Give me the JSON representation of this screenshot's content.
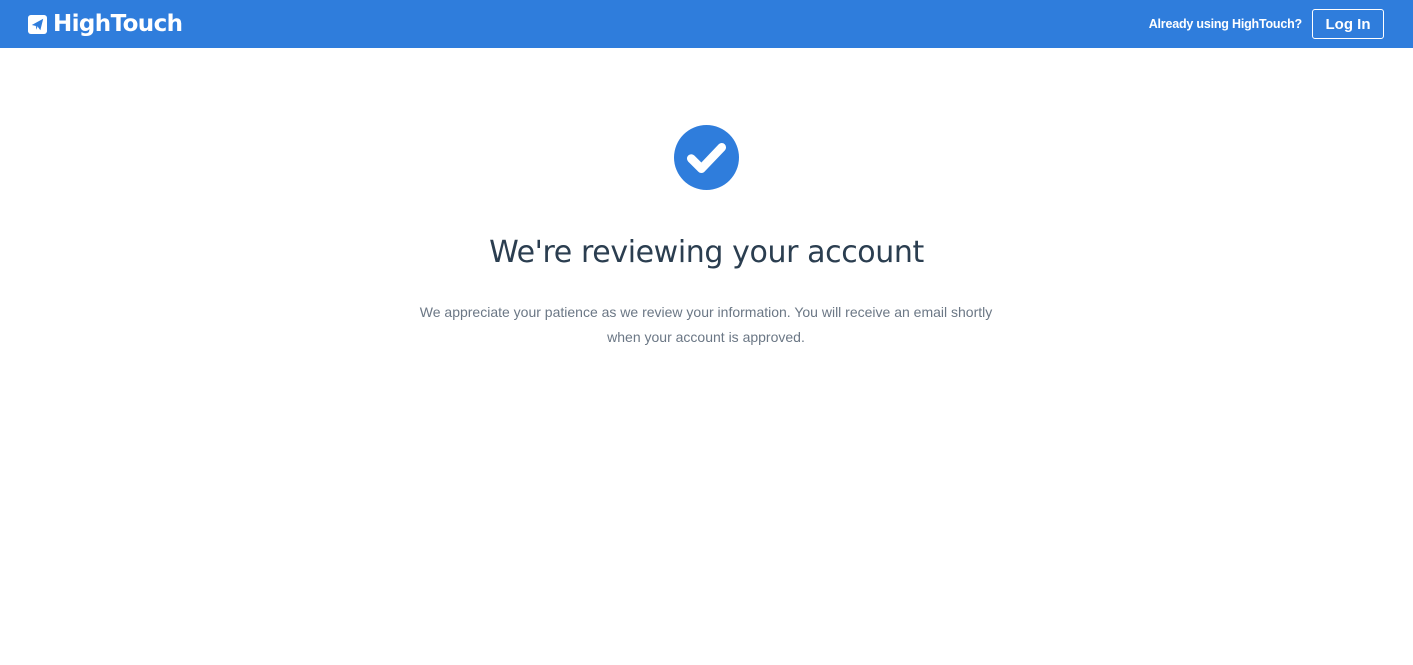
{
  "header": {
    "brand_name": "HighTouch",
    "brand_icon": "paper-plane-icon",
    "already_text": "Already using HighTouch?",
    "login_label": "Log In",
    "background_color": "#2f7ddc"
  },
  "main": {
    "status_icon": "check-circle-icon",
    "title": "We're reviewing your account",
    "message_line1": "We appreciate your patience as we review your information. You will receive an email shortly",
    "message_line2": "when your account is approved.",
    "accent_color": "#2f7ddc",
    "title_color": "#2b3e50",
    "text_color": "#6b7785"
  }
}
